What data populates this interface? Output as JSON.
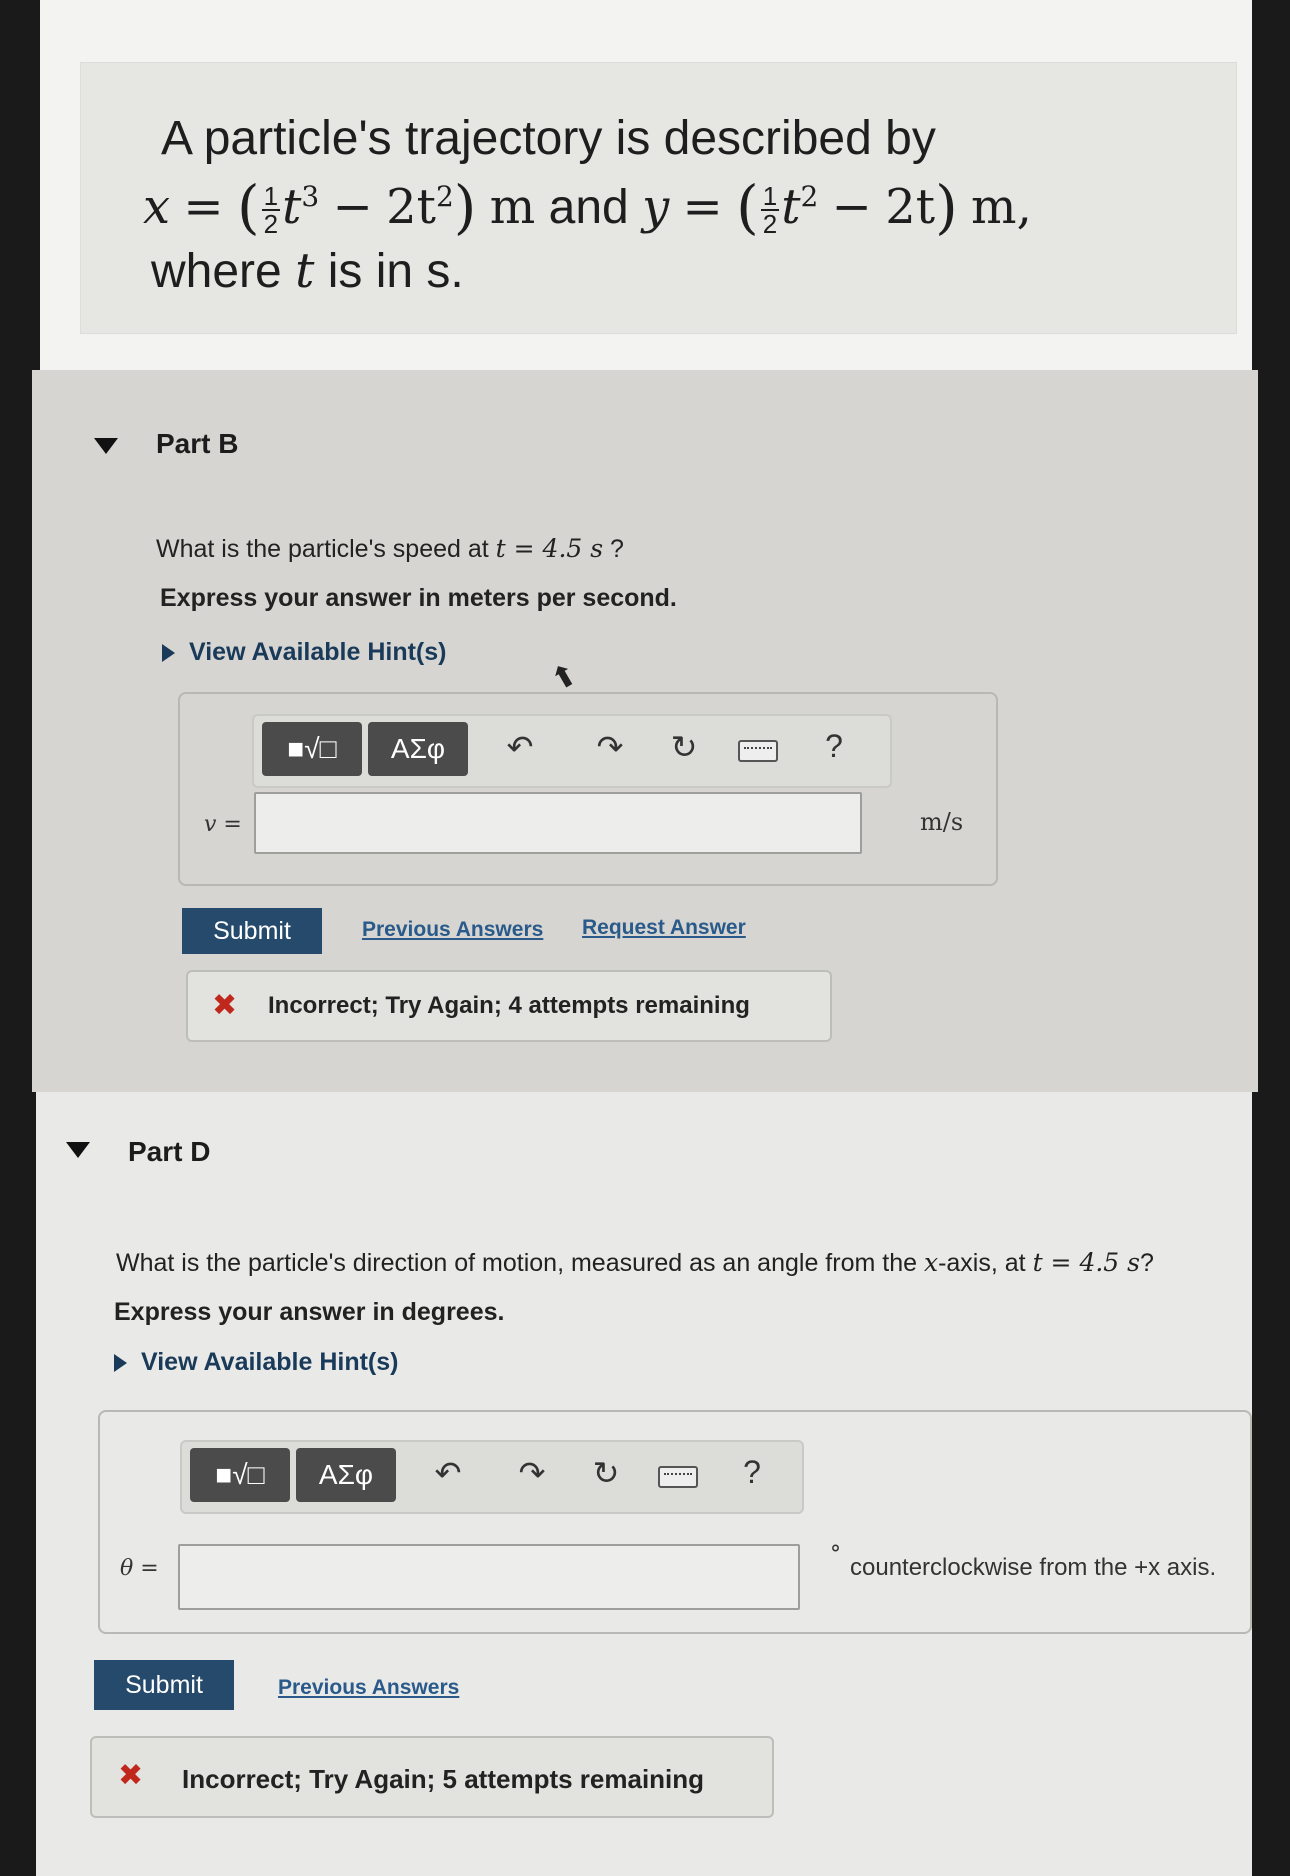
{
  "statement": {
    "line1": "A particle's trajectory is described by",
    "x_var": "x",
    "eq": "=",
    "frac_num": "1",
    "frac_den": "2",
    "x_term1": "t",
    "x_exp1": "3",
    "x_minus": "−",
    "x_term2": "2t",
    "x_exp2": "2",
    "unit_m": "m",
    "and": "and",
    "y_var": "y",
    "y_term1": "t",
    "y_exp1": "2",
    "y_term2": "2t",
    "unit_m_comma": "m,",
    "line3_pre": "where",
    "line3_t": "t",
    "line3_post": "is in s."
  },
  "partB": {
    "title": "Part B",
    "question_pre": "What is the particle's speed at",
    "question_math": "t = 4.5 s",
    "question_post": "?",
    "instruction": "Express your answer in meters per second.",
    "hint": "View Available Hint(s)",
    "toolbar": {
      "templates_label": "■√□",
      "greek_label": "ΑΣφ",
      "help": "?"
    },
    "answer_label": "v =",
    "answer_value": "",
    "unit": "m/s",
    "submit": "Submit",
    "previous_answers": "Previous Answers",
    "request_answer": "Request Answer",
    "feedback": "Incorrect; Try Again; 4 attempts remaining"
  },
  "partD": {
    "title": "Part D",
    "question_pre": "What is the particle's direction of motion, measured as an angle from the",
    "question_axis": "x",
    "question_mid": "-axis, at",
    "question_math": "t = 4.5 s",
    "question_post": "?",
    "instruction": "Express your answer in degrees.",
    "hint": "View Available Hint(s)",
    "toolbar": {
      "templates_label": "■√□",
      "greek_label": "ΑΣφ",
      "help": "?"
    },
    "answer_label": "θ =",
    "answer_value": "",
    "unit_degree": "°",
    "unit_text": "counterclockwise from the +x axis.",
    "submit": "Submit",
    "previous_answers": "Previous Answers",
    "feedback": "Incorrect; Try Again; 5 attempts remaining"
  },
  "icons": {
    "undo": "↶",
    "redo": "↷",
    "reset": "↻",
    "cross": "✖",
    "cursor": "⬆"
  },
  "colors": {
    "submit_bg": "#254a6c",
    "link": "#2a5a8a",
    "error_x": "#c0281e"
  }
}
